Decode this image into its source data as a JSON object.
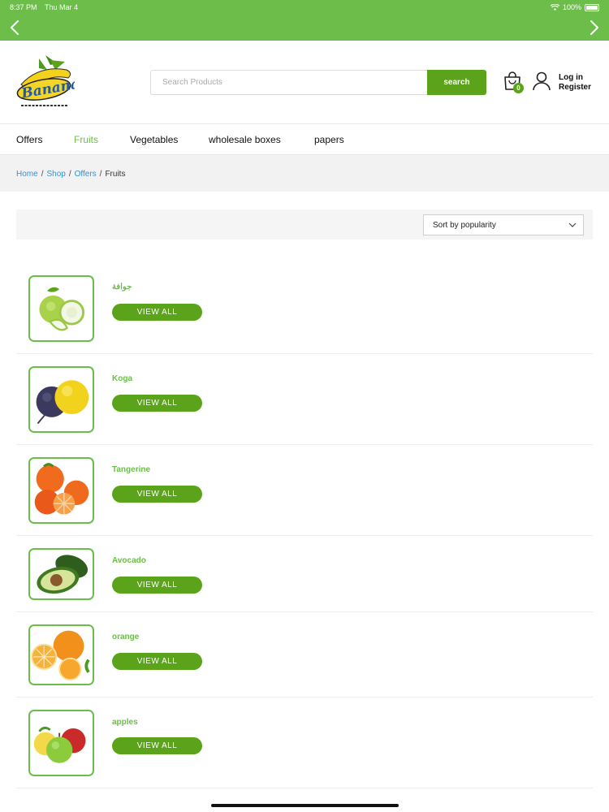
{
  "status": {
    "time": "8:37 PM",
    "date": "Thu Mar 4",
    "battery": "100%"
  },
  "colors": {
    "brand_green": "#6cbd4a",
    "button_green": "#5aa31a",
    "link_blue": "#3b8fc6"
  },
  "header": {
    "logo_name": "banana-logo",
    "search": {
      "placeholder": "Search Products",
      "button_label": "search"
    },
    "cart_count": "0",
    "login_label": "Log in",
    "register_label": "Register"
  },
  "menu": {
    "items": [
      {
        "label": "Offers",
        "active": false
      },
      {
        "label": "Fruits",
        "active": true
      },
      {
        "label": "Vegetables",
        "active": false
      },
      {
        "label": "wholesale boxes",
        "active": false
      },
      {
        "label": "papers",
        "active": false
      }
    ]
  },
  "breadcrumb": {
    "home": "Home",
    "shop": "Shop",
    "offers": "Offers",
    "current": "Fruits",
    "sep": "/"
  },
  "sort": {
    "selected": "Sort by popularity"
  },
  "products": [
    {
      "name": "جوافة",
      "button": "VIEW ALL",
      "image": "guava"
    },
    {
      "name": "Koga",
      "button": "VIEW ALL",
      "image": "plum-and-yellow-fruit"
    },
    {
      "name": "Tangerine",
      "button": "VIEW ALL",
      "image": "tangerine"
    },
    {
      "name": "Avocado",
      "button": "VIEW ALL",
      "image": "avocado"
    },
    {
      "name": "orange",
      "button": "VIEW ALL",
      "image": "orange"
    },
    {
      "name": "apples",
      "button": "VIEW ALL",
      "image": "apples"
    }
  ]
}
